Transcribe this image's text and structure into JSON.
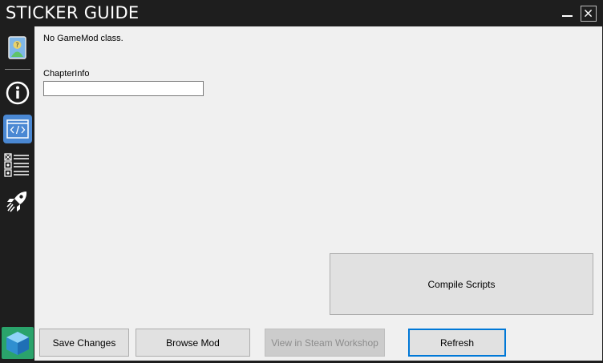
{
  "window": {
    "title": "STICKER GUIDE",
    "minimize_glyph": "—",
    "close_glyph": "✕"
  },
  "sidebar": {
    "items": [
      {
        "name": "mod-info-icon",
        "active": false
      },
      {
        "name": "info-icon",
        "active": false
      },
      {
        "name": "code-icon",
        "active": true
      },
      {
        "name": "checklist-icon",
        "active": false
      },
      {
        "name": "rocket-icon",
        "active": false
      },
      {
        "name": "cube-icon",
        "active": false
      }
    ],
    "accent_color": "#4a88d3"
  },
  "main": {
    "status_message": "No GameMod class.",
    "chapter_info": {
      "label": "ChapterInfo",
      "value": ""
    },
    "compile_button": "Compile Scripts"
  },
  "footer": {
    "save_button": "Save Changes",
    "browse_button": "Browse Mod",
    "workshop_button": "View in Steam Workshop",
    "refresh_button": "Refresh"
  }
}
